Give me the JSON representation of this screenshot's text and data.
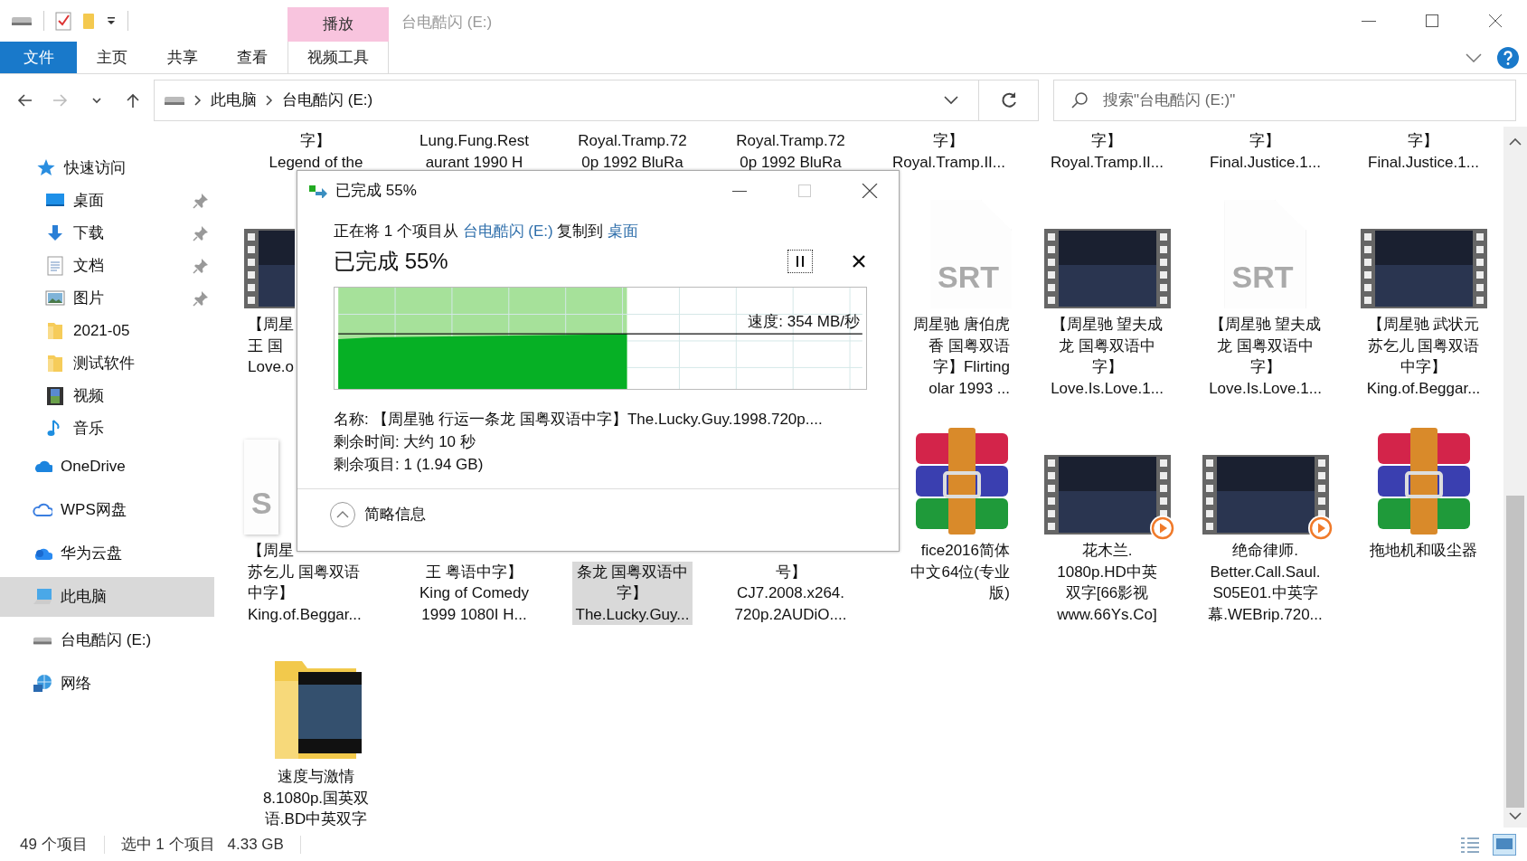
{
  "titlebar": {
    "context_tab": "播放",
    "title": "台电酷闪 (E:)"
  },
  "ribbon": {
    "tabs": [
      {
        "label": "文件",
        "kind": "file"
      },
      {
        "label": "主页",
        "kind": "normal"
      },
      {
        "label": "共享",
        "kind": "normal"
      },
      {
        "label": "查看",
        "kind": "normal"
      },
      {
        "label": "视频工具",
        "kind": "context"
      }
    ]
  },
  "address": {
    "crumbs": [
      "此电脑",
      "台电酷闪 (E:)"
    ],
    "search_placeholder": "搜索\"台电酷闪 (E:)\""
  },
  "sidebar": {
    "items": [
      {
        "label": "快速访问",
        "selected": false,
        "children": [
          {
            "label": "桌面",
            "pinned": true,
            "selected": false
          },
          {
            "label": "下载",
            "pinned": true,
            "selected": false
          },
          {
            "label": "文档",
            "pinned": true,
            "selected": false
          },
          {
            "label": "图片",
            "pinned": true,
            "selected": false
          },
          {
            "label": "2021-05",
            "pinned": false,
            "selected": false
          },
          {
            "label": "测试软件",
            "pinned": false,
            "selected": false
          },
          {
            "label": "视频",
            "pinned": false,
            "selected": false
          },
          {
            "label": "音乐",
            "pinned": false,
            "selected": false
          }
        ]
      },
      {
        "label": "OneDrive",
        "selected": false
      },
      {
        "label": "WPS网盘",
        "selected": false
      },
      {
        "label": "华为云盘",
        "selected": false
      },
      {
        "label": "此电脑",
        "selected": true
      },
      {
        "label": "台电酷闪 (E:)",
        "selected": false
      },
      {
        "label": "网络",
        "selected": false
      }
    ]
  },
  "files": {
    "rows": [
      [
        {
          "selected": false,
          "lines": [
            "字】",
            "Legend of the"
          ]
        },
        {
          "selected": false,
          "lines": [
            "Lung.Fung.Rest",
            "aurant 1990 H"
          ]
        },
        {
          "selected": false,
          "lines": [
            "Royal.Tramp.72",
            "0p 1992 BluRa"
          ]
        },
        {
          "selected": false,
          "lines": [
            "Royal.Tramp.72",
            "0p 1992 BluRa"
          ]
        },
        {
          "selected": false,
          "lines": [
            "字】",
            "Royal.Tramp.II..."
          ]
        },
        {
          "selected": false,
          "lines": [
            "字】",
            "Royal.Tramp.II..."
          ]
        },
        {
          "selected": false,
          "lines": [
            "字】",
            "Final.Justice.1..."
          ]
        },
        {
          "selected": false,
          "lines": [
            "字】",
            "Final.Justice.1..."
          ]
        }
      ],
      [
        {
          "kind": "video",
          "play": false,
          "selected": false,
          "lines": [
            "【周星",
            "王 国",
            "Love.o"
          ]
        },
        "",
        "",
        "",
        {
          "kind": "srt",
          "badge": "SRT",
          "selected": false,
          "lines": [
            "周星驰 唐伯虎",
            "香 国粤双语",
            "字】Flirting",
            "olar 1993 ..."
          ]
        },
        {
          "kind": "video",
          "play": false,
          "selected": false,
          "lines": [
            "【周星驰 望夫成",
            "龙 国粤双语中",
            "字】",
            "Love.Is.Love.1..."
          ]
        },
        {
          "kind": "srt",
          "badge": "SRT",
          "selected": false,
          "lines": [
            "【周星驰 望夫成",
            "龙 国粤双语中",
            "字】",
            "Love.Is.Love.1..."
          ]
        },
        {
          "kind": "video",
          "play": false,
          "selected": false,
          "lines": [
            "【周星驰 武状元",
            "苏乞儿 国粤双语",
            "中字】",
            "King.of.Beggar..."
          ]
        }
      ],
      [
        {
          "kind": "srt",
          "badge": "S",
          "selected": false,
          "lines": [
            "【周星",
            "苏乞儿 国粤双语",
            "中字】",
            "King.of.Beggar..."
          ]
        },
        {
          "kind": "none",
          "selected": false,
          "lines": [
            "王 粤语中字】",
            "King of Comedy",
            "1999 1080I H..."
          ]
        },
        {
          "kind": "none",
          "selected": true,
          "lines": [
            "条龙 国粤双语中",
            "字】",
            "The.Lucky.Guy..."
          ]
        },
        {
          "kind": "none",
          "selected": false,
          "lines": [
            "号】",
            "CJ7.2008.x264.",
            "720p.2AUDiO...."
          ]
        },
        {
          "kind": "archive",
          "selected": false,
          "lines": [
            "fice2016简体",
            "中文64位(专业",
            "版)"
          ]
        },
        {
          "kind": "video",
          "play": true,
          "selected": false,
          "lines": [
            "花木兰.",
            "1080p.HD中英",
            "双字[66影视",
            "www.66Ys.Co]"
          ]
        },
        {
          "kind": "video",
          "play": true,
          "selected": false,
          "lines": [
            "绝命律师.",
            "Better.Call.Saul.",
            "S05E01.中英字",
            "幕.WEBrip.720..."
          ]
        },
        {
          "kind": "archive",
          "selected": false,
          "lines": [
            "拖地机和吸尘器"
          ]
        }
      ],
      [
        {
          "kind": "folder",
          "selected": false,
          "lines": [
            "速度与激情",
            "8.1080p.国英双",
            "语.BD中英双字"
          ]
        }
      ]
    ]
  },
  "dialog": {
    "title": "已完成 55%",
    "status_prefix": "正在将 1 个项目从",
    "source": "台电酷闪 (E:)",
    "status_middle": "复制到",
    "destination": "桌面",
    "heading": "已完成 55%",
    "level": 0.55,
    "speed": "速度: 354 MB/秒",
    "details": [
      "名称: 【周星驰 行运一条龙 国粤双语中字】The.Lucky.Guy.1998.720p....",
      "剩余时间: 大约 10 秒",
      "剩余项目: 1 (1.94 GB)"
    ],
    "toggle": "简略信息"
  },
  "status_bar": {
    "count": "49 个项目",
    "selection": "选中 1 个项目",
    "size": "4.33 GB"
  }
}
